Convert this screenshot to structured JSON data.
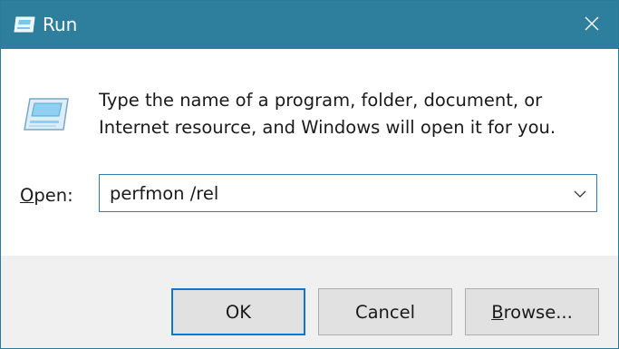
{
  "window": {
    "title": "Run",
    "title_bar_color": "#2d7f9d"
  },
  "titlebar": {
    "app_icon": "run-icon",
    "close_icon": "close-icon"
  },
  "dialog": {
    "icon": "run-icon",
    "description": "Type the name of a program, folder, document, or Internet resource, and Windows will open it for you.",
    "open_label_mnemonic": "O",
    "open_label_rest": "pen:",
    "input_value": "perfmon /rel",
    "dropdown_icon": "chevron-down-icon"
  },
  "buttons": {
    "ok_label": "OK",
    "cancel_label": "Cancel",
    "browse_mnemonic": "B",
    "browse_rest": "rowse..."
  },
  "colors": {
    "accent": "#0b78d7",
    "footer_bg": "#f0f0f0",
    "button_bg": "#e1e1e1"
  }
}
